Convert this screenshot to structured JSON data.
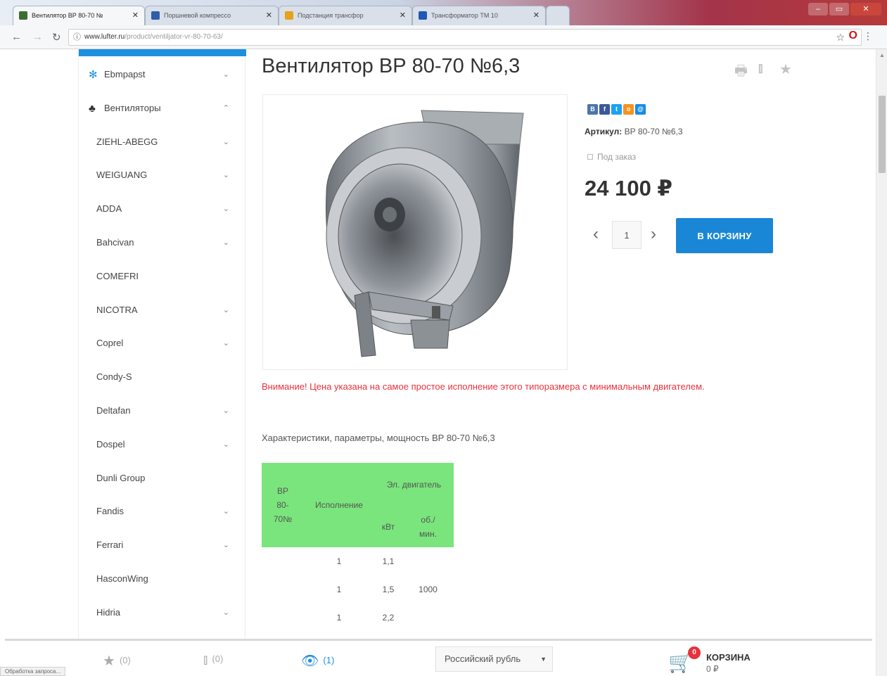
{
  "browser": {
    "tabs": [
      {
        "title": "Вентилятор ВР 80-70 №",
        "color": "#3c6e34"
      },
      {
        "title": "Поршневой компрессо",
        "color": "#2f5ea8"
      },
      {
        "title": "Подстанция трансфор",
        "color": "#e6a21a"
      },
      {
        "title": "Трансформатор ТМ 10",
        "color": "#1f58b3"
      }
    ],
    "url_host": "www.lufter.ru",
    "url_path": "/product/ventiljator-vr-80-70-63/",
    "status_text": "Обработка запроса..."
  },
  "sidebar": {
    "items": [
      {
        "label": "Ebmpapst",
        "icon": "fan-icon",
        "chevron": "⌄",
        "top": true
      },
      {
        "label": "Вентиляторы",
        "icon": "blades-icon",
        "chevron": "⌃",
        "top": true
      },
      {
        "label": "ZIEHL-ABEGG",
        "chevron": "⌄"
      },
      {
        "label": "WEIGUANG",
        "chevron": "⌄"
      },
      {
        "label": "ADDA",
        "chevron": "⌄"
      },
      {
        "label": "Bahcivan",
        "chevron": "⌄"
      },
      {
        "label": "COMEFRI",
        "chevron": ""
      },
      {
        "label": "NICOTRA",
        "chevron": "⌄"
      },
      {
        "label": "Coprel",
        "chevron": "⌄"
      },
      {
        "label": "Condy-S",
        "chevron": ""
      },
      {
        "label": "Deltafan",
        "chevron": "⌄"
      },
      {
        "label": "Dospel",
        "chevron": "⌄"
      },
      {
        "label": "Dunli Group",
        "chevron": ""
      },
      {
        "label": "Fandis",
        "chevron": "⌄"
      },
      {
        "label": "Ferrari",
        "chevron": "⌄"
      },
      {
        "label": "HasconWing",
        "chevron": ""
      },
      {
        "label": "Hidria",
        "chevron": "⌄"
      }
    ]
  },
  "product": {
    "title": "Вентилятор ВР 80-70 №6,3",
    "sku_label": "Артикул:",
    "sku_value": "ВР 80-70 №6,3",
    "availability": "Под заказ",
    "price": "24 100 ₽",
    "quantity": "1",
    "cart_button": "в корзину",
    "share_icons": [
      {
        "label": "В",
        "color": "#4a76a8"
      },
      {
        "label": "f",
        "color": "#3b5998"
      },
      {
        "label": "t",
        "color": "#1da1f2"
      },
      {
        "label": "o",
        "color": "#f7931e"
      },
      {
        "label": "@",
        "color": "#168de2"
      }
    ]
  },
  "notice": "Внимание! Цена указана на самое простое исполнение этого типоразмера с минимальным двигателем.",
  "specs": {
    "heading": "Характеристики, параметры, мощность ВР 80-70 №6,3",
    "header_model": "ВР 80-70№",
    "header_execution": "Исполнение",
    "header_motor": "Эл. двигатель",
    "header_kw": "кВт",
    "header_rpm": "об./мин.",
    "rows": [
      {
        "execution": "1",
        "kw": "1,1"
      },
      {
        "execution": "1",
        "kw": "1,5"
      },
      {
        "execution": "1",
        "kw": "2,2"
      }
    ],
    "rpm_value": "1000"
  },
  "bottom_bar": {
    "favorites": "(0)",
    "compare": "(0)",
    "views": "(1)",
    "currency": "Российский рубль",
    "cart_count": "0",
    "cart_label": "КОРЗИНА",
    "cart_sum": "0 ₽"
  },
  "colors": {
    "accent": "#1a87d6",
    "notice": "#e8323c",
    "table_header": "#7ae57c"
  }
}
